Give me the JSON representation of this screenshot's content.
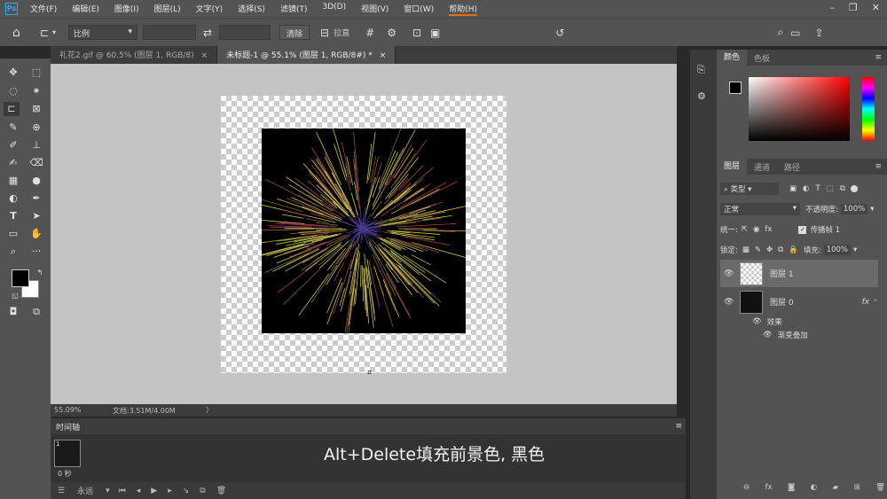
{
  "app": {
    "logo": "Ps"
  },
  "menu": [
    "文件(F)",
    "编辑(E)",
    "图像(I)",
    "图层(L)",
    "文字(Y)",
    "选择(S)",
    "滤镜(T)",
    "3D(D)",
    "视图(V)",
    "窗口(W)",
    "帮助(H)"
  ],
  "options": {
    "ratio": "比例",
    "clear": "清除",
    "straighten": "拉直"
  },
  "tabs": [
    {
      "label": "礼花2.gif @ 60.5% (图层 1, RGB/8)"
    },
    {
      "label": "未标题-1 @ 55.1% (图层 1, RGB/8#) *"
    }
  ],
  "status": {
    "zoom": "55.09%",
    "doc": "文档:3.51M/4.00M"
  },
  "timeline": {
    "title": "时间轴",
    "frame_time": "0 秒",
    "loop": "永远"
  },
  "subtitle": "Alt+Delete填充前景色, 黑色",
  "color_panel": {
    "tab_color": "颜色",
    "tab_swatches": "色板",
    "base_hue": "#ff0000"
  },
  "layers_panel": {
    "tabs": [
      "图层",
      "通道",
      "路径"
    ],
    "filter": "类型",
    "blend": "正常",
    "opacity_label": "不透明度:",
    "opacity": "100%",
    "unify_label": "统一:",
    "propagate": "传播帧 1",
    "lock_label": "锁定:",
    "fill_label": "填充:",
    "fill": "100%",
    "layers": [
      {
        "name": "图层 1"
      },
      {
        "name": "图层 0"
      }
    ],
    "effects_label": "效果",
    "effect": "渐变叠加"
  }
}
